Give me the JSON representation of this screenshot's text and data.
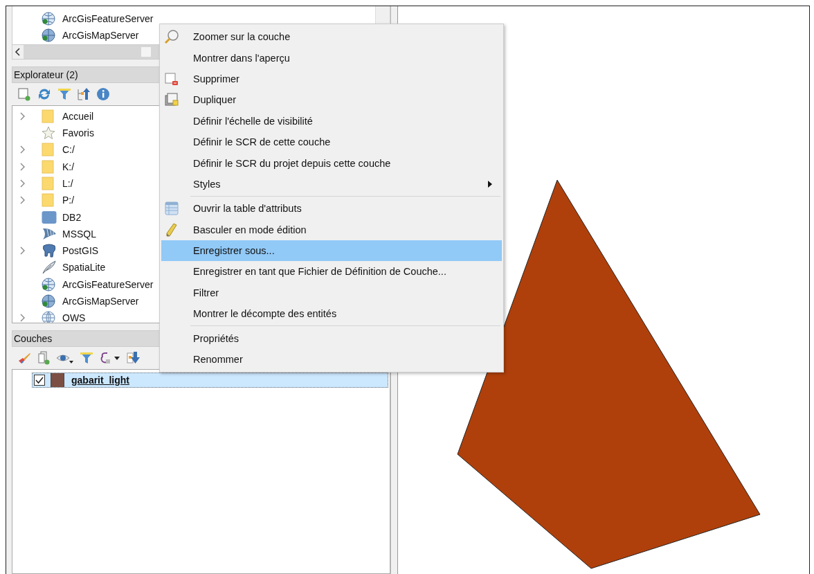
{
  "top_browser": {
    "items": [
      {
        "label": "ArcGisFeatureServer",
        "kind": "globe-server",
        "has_children": false
      },
      {
        "label": "ArcGisMapServer",
        "kind": "globe-map",
        "has_children": false
      }
    ]
  },
  "browser_panel": {
    "title": "Explorateur (2)",
    "items": [
      {
        "label": "Accueil",
        "kind": "folder",
        "has_children": true
      },
      {
        "label": "Favoris",
        "kind": "star",
        "has_children": false
      },
      {
        "label": "C:/",
        "kind": "folder",
        "has_children": true
      },
      {
        "label": "K:/",
        "kind": "folder",
        "has_children": true
      },
      {
        "label": "L:/",
        "kind": "folder",
        "has_children": true
      },
      {
        "label": "P:/",
        "kind": "folder",
        "has_children": true
      },
      {
        "label": "DB2",
        "kind": "db2",
        "has_children": false
      },
      {
        "label": "MSSQL",
        "kind": "mssql",
        "has_children": false
      },
      {
        "label": "PostGIS",
        "kind": "postgis",
        "has_children": true
      },
      {
        "label": "SpatiaLite",
        "kind": "feather",
        "has_children": false
      },
      {
        "label": "ArcGisFeatureServer",
        "kind": "globe-server",
        "has_children": false
      },
      {
        "label": "ArcGisMapServer",
        "kind": "globe-map",
        "has_children": false
      },
      {
        "label": "OWS",
        "kind": "globe",
        "has_children": true
      }
    ]
  },
  "layers_panel": {
    "title": "Couches",
    "layers": [
      {
        "label": "gabarit_light",
        "checked": true,
        "selected": true
      }
    ]
  },
  "context_menu": {
    "items": [
      {
        "kind": "zoom",
        "label": "Zoomer sur la couche",
        "submenu": false,
        "selected": false
      },
      {
        "kind": "plain",
        "label": "Montrer dans l'aperçu",
        "submenu": false,
        "selected": false
      },
      {
        "kind": "remove",
        "label": "Supprimer",
        "submenu": false,
        "selected": false
      },
      {
        "kind": "duplicate",
        "label": "Dupliquer",
        "submenu": false,
        "selected": false
      },
      {
        "kind": "plain",
        "label": "Définir l'échelle de visibilité",
        "submenu": false,
        "selected": false
      },
      {
        "kind": "plain",
        "label": "Définir le SCR de cette couche",
        "submenu": false,
        "selected": false
      },
      {
        "kind": "plain",
        "label": "Définir le SCR du projet depuis cette couche",
        "submenu": false,
        "selected": false
      },
      {
        "kind": "plain",
        "label": "Styles",
        "submenu": true,
        "selected": false
      },
      {
        "kind": "separator"
      },
      {
        "kind": "table",
        "label": "Ouvrir la table d'attributs",
        "submenu": false,
        "selected": false
      },
      {
        "kind": "pencil",
        "label": "Basculer en mode édition",
        "submenu": false,
        "selected": false
      },
      {
        "kind": "plain",
        "label": "Enregistrer sous...",
        "submenu": false,
        "selected": true
      },
      {
        "kind": "plain",
        "label": "Enregistrer en tant que Fichier de Définition de Couche...",
        "submenu": false,
        "selected": false
      },
      {
        "kind": "plain",
        "label": "Filtrer",
        "submenu": false,
        "selected": false
      },
      {
        "kind": "plain",
        "label": "Montrer le décompte des entités",
        "submenu": false,
        "selected": false
      },
      {
        "kind": "separator"
      },
      {
        "kind": "plain",
        "label": "Propriétés",
        "submenu": false,
        "selected": false
      },
      {
        "kind": "plain",
        "label": "Renommer",
        "submenu": false,
        "selected": false
      }
    ]
  }
}
